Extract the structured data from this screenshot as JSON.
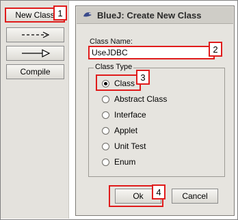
{
  "toolbar": {
    "new_class_label": "New Class",
    "compile_label": "Compile",
    "uses_arrow_icon": "dashed-arrow-icon",
    "inherits_arrow_icon": "hollow-arrow-icon"
  },
  "dialog": {
    "title": "BlueJ:  Create New Class",
    "class_name_label": "Class Name:",
    "class_name_value": "UseJDBC",
    "class_type_label": "Class Type",
    "class_types": [
      {
        "label": "Class",
        "selected": true
      },
      {
        "label": "Abstract Class",
        "selected": false
      },
      {
        "label": "Interface",
        "selected": false
      },
      {
        "label": "Applet",
        "selected": false
      },
      {
        "label": "Unit Test",
        "selected": false
      },
      {
        "label": "Enum",
        "selected": false
      }
    ],
    "ok_label": "Ok",
    "cancel_label": "Cancel"
  },
  "callouts": [
    "1",
    "2",
    "3",
    "4"
  ],
  "colors": {
    "callout_red": "#e01b1b",
    "dialog_bg": "#e6e4df",
    "toolbar_bg": "#e4e2dd"
  }
}
